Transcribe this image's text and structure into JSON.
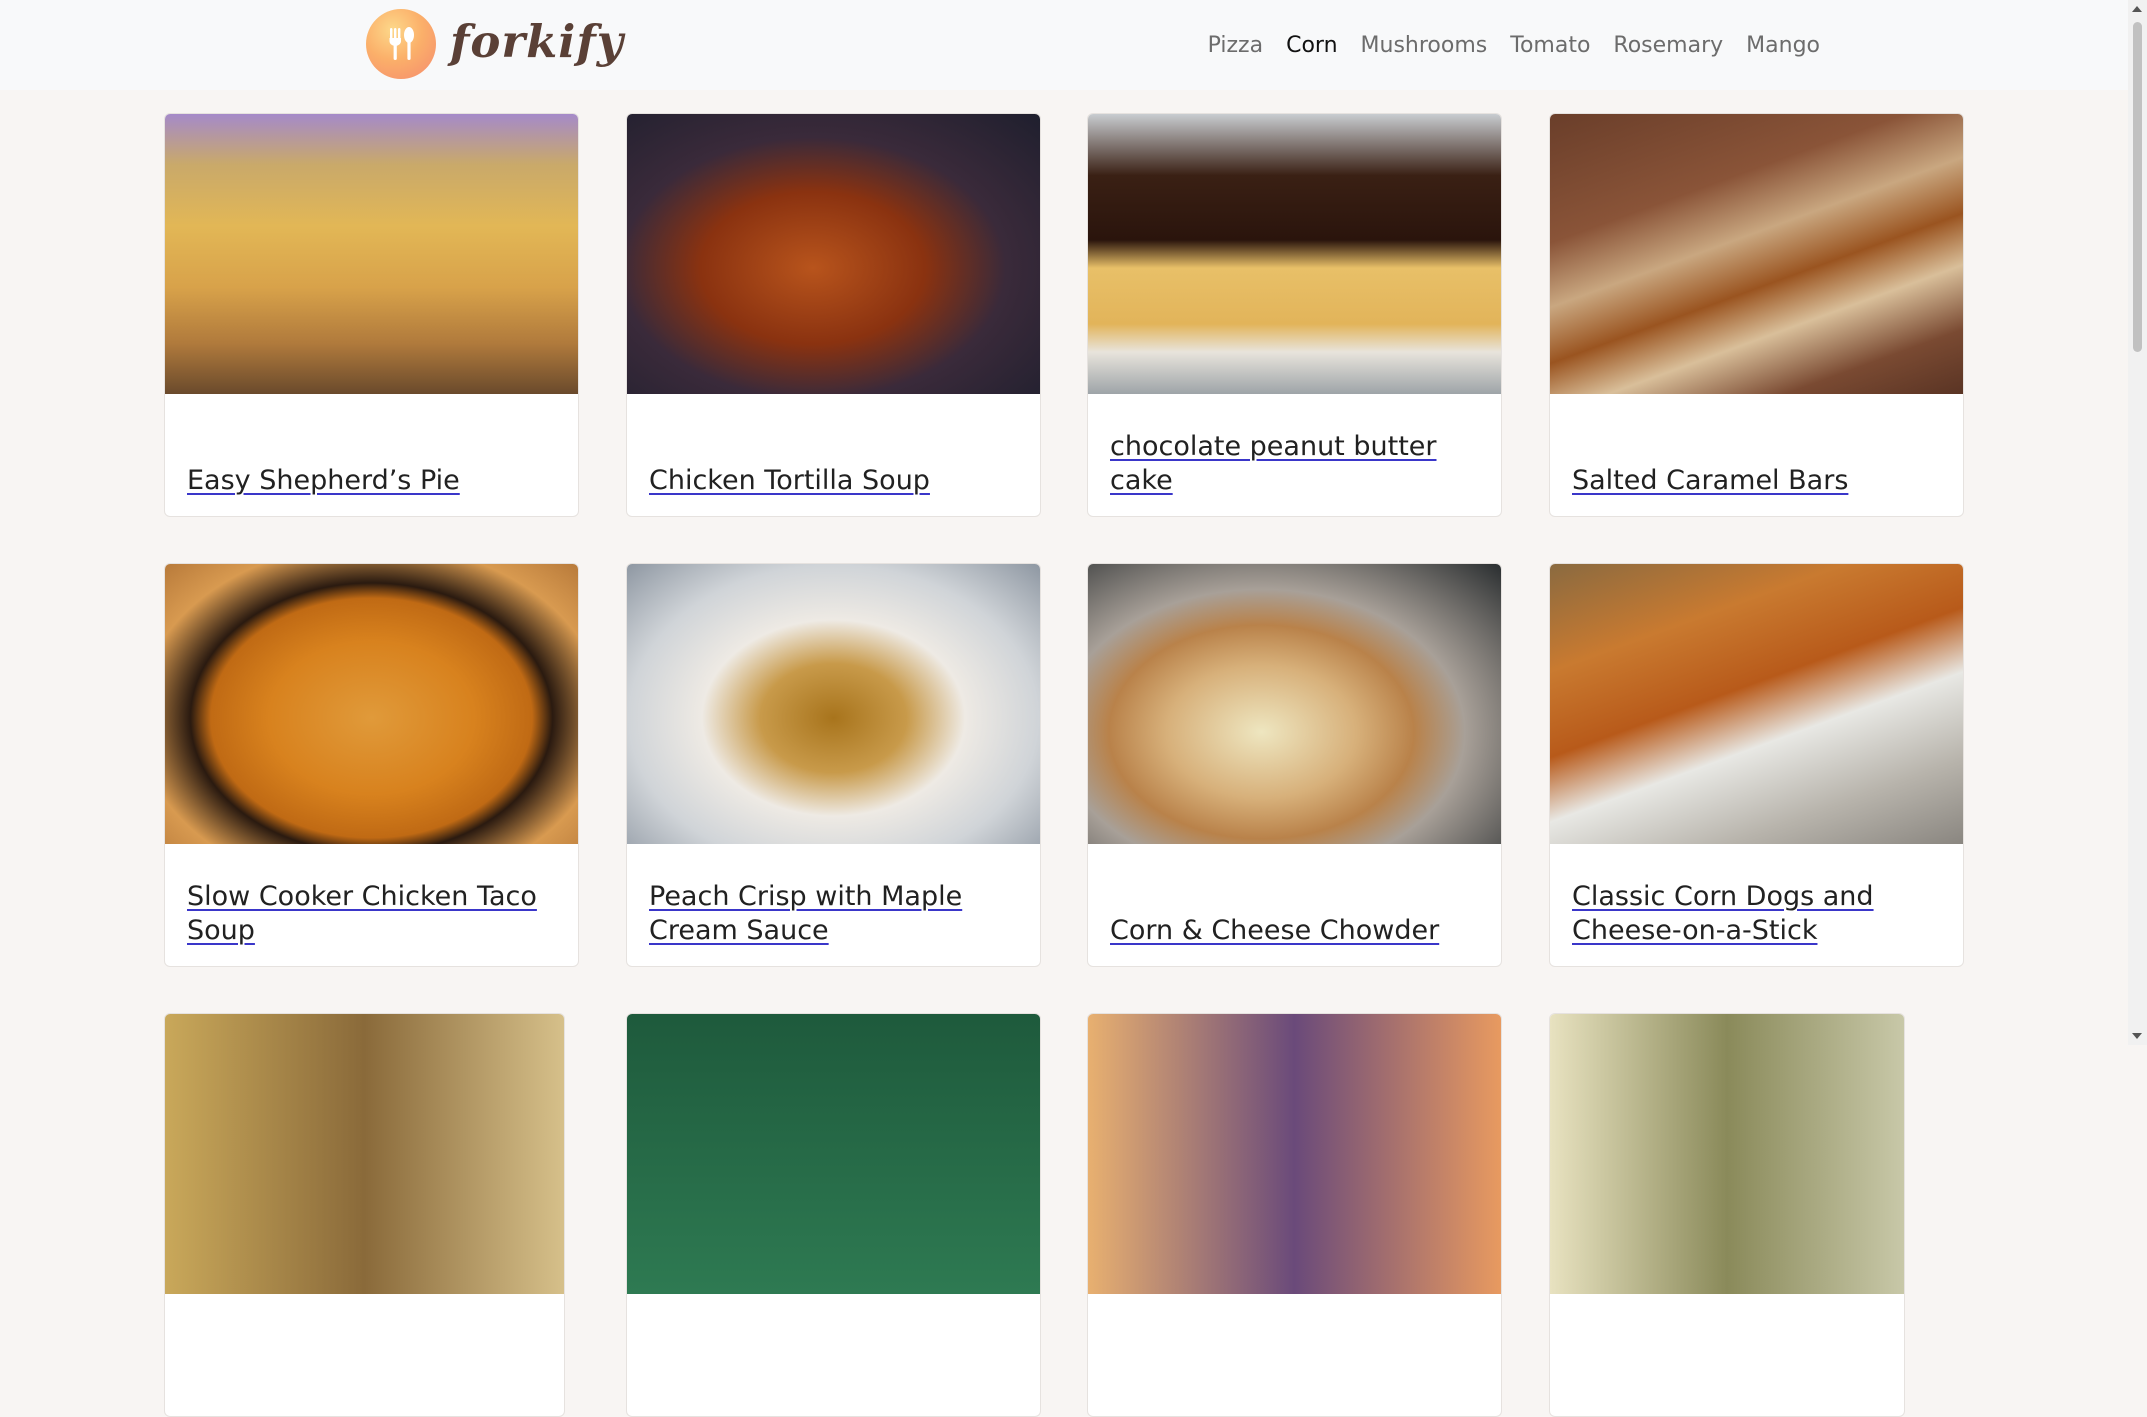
{
  "brand": {
    "name": "forkify"
  },
  "nav": {
    "items": [
      {
        "label": "Pizza",
        "active": false
      },
      {
        "label": "Corn",
        "active": true
      },
      {
        "label": "Mushrooms",
        "active": false
      },
      {
        "label": "Tomato",
        "active": false
      },
      {
        "label": "Rosemary",
        "active": false
      },
      {
        "label": "Mango",
        "active": false
      }
    ]
  },
  "recipes": [
    {
      "title": "Easy Shepherd’s Pie"
    },
    {
      "title": "Chicken Tortilla Soup"
    },
    {
      "title": "chocolate peanut butter cake"
    },
    {
      "title": "Salted Caramel Bars"
    },
    {
      "title": "Slow Cooker Chicken Taco Soup"
    },
    {
      "title": "Peach Crisp with Maple Cream Sauce"
    },
    {
      "title": "Corn & Cheese Chowder"
    },
    {
      "title": "Classic Corn Dogs and Cheese-on-a-Stick"
    }
  ],
  "colors": {
    "page_bg": "#f8f5f3",
    "header_bg": "#f8f9fa",
    "link_underline": "#3a36c9",
    "logo_gradient": [
      "#fdd88a",
      "#f58a6d"
    ]
  }
}
